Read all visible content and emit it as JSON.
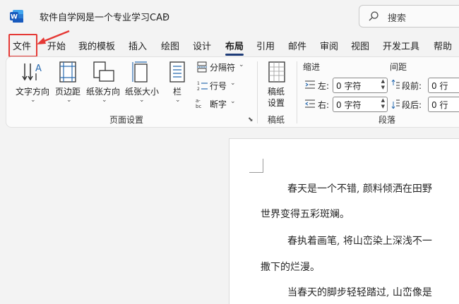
{
  "title_bar": {
    "document_title": "软件自学网是一个专业学习CAD",
    "search_placeholder": "搜索"
  },
  "tabs": [
    "文件",
    "开始",
    "我的模板",
    "插入",
    "绘图",
    "设计",
    "布局",
    "引用",
    "邮件",
    "审阅",
    "视图",
    "开发工具",
    "帮助"
  ],
  "active_tab": "布局",
  "ribbon": {
    "page_setup": {
      "text_direction": "文字方向",
      "margins": "页边距",
      "orientation": "纸张方向",
      "size": "纸张大小",
      "columns": "栏",
      "breaks": "分隔符",
      "line_numbers": "行号",
      "hyphenation": "断字",
      "group_label": "页面设置"
    },
    "manuscript": {
      "setup_line1": "稿纸",
      "setup_line2": "设置",
      "group_label": "稿纸"
    },
    "paragraph": {
      "indent_label": "缩进",
      "spacing_label": "间距",
      "left_label": "左:",
      "right_label": "右:",
      "before_label": "段前:",
      "after_label": "段后:",
      "left_value": "0 字符",
      "right_value": "0 字符",
      "before_value": "0 行",
      "after_value": "0 行",
      "group_label": "段落"
    }
  },
  "document": {
    "lines": [
      "春天是一个不错, 颜料倾洒在田野",
      "世界变得五彩斑斓。",
      "春执着画笔, 将山峦染上深浅不一",
      "撒下的烂漫。",
      "当春天的脚步轻轻踏过, 山峦像是"
    ]
  },
  "colors": {
    "highlight_red": "#e53935",
    "word_blue": "#185abd",
    "active_underline": "#1e3c78"
  }
}
